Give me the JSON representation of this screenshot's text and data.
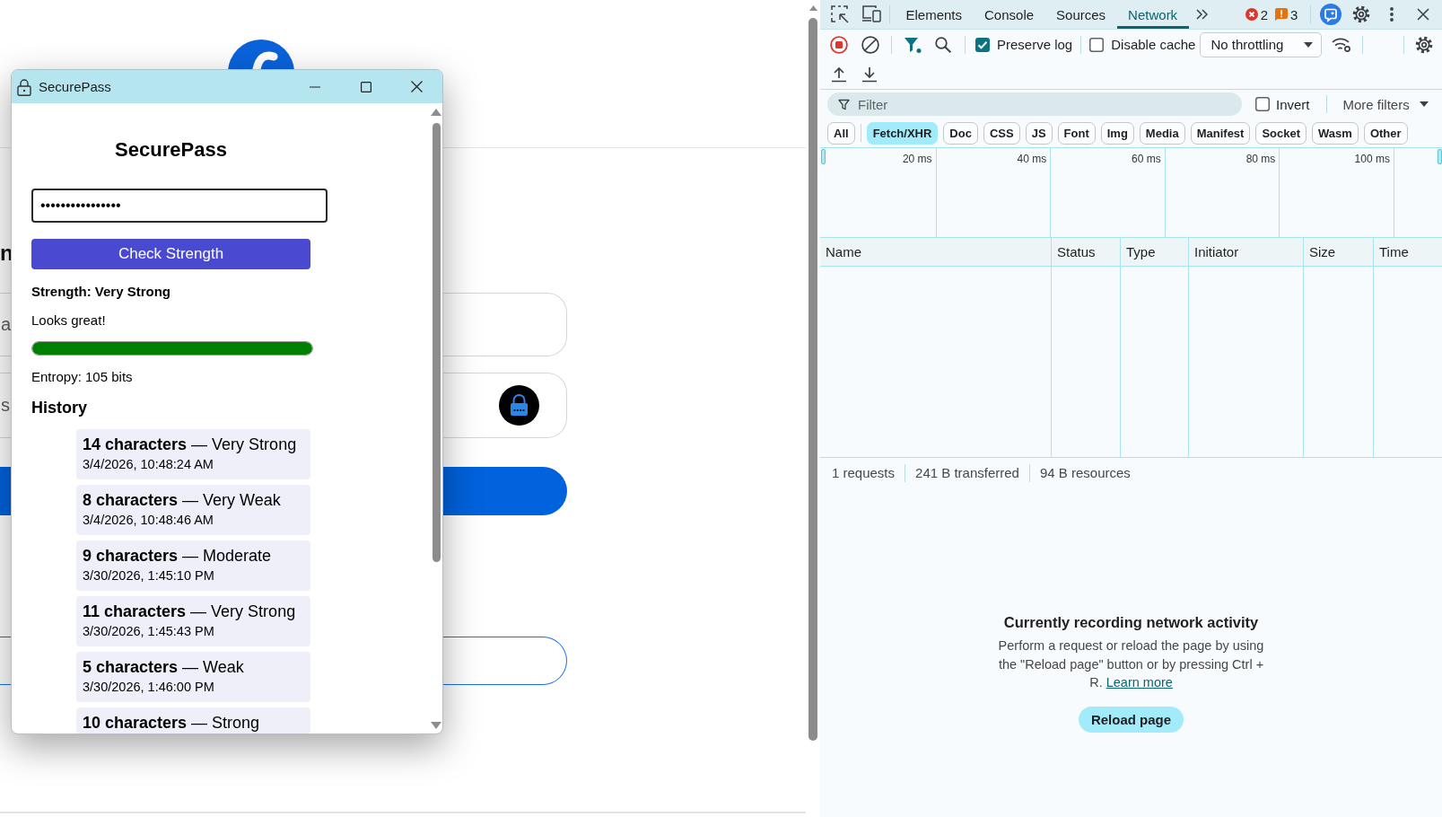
{
  "page_behind": {
    "heading": "n",
    "fields": [
      {
        "kind": "text",
        "text": "a"
      },
      {
        "kind": "password",
        "text": "s"
      }
    ]
  },
  "popup": {
    "title": "SecurePass",
    "heading": "SecurePass",
    "password_field": {
      "value": "••••••••••••••••"
    },
    "check_button": "Check Strength",
    "strength": "Strength: Very Strong",
    "message": "Looks great!",
    "strength_meter": {
      "level": 1
    },
    "entropy": "Entropy: 105 bits",
    "history_title": "History",
    "history": [
      {
        "title": "**14 characters** — Very Strong",
        "time": "3/4/2026, 10:48:24 AM"
      },
      {
        "title": "**8 characters** — Very Weak",
        "time": "3/4/2026, 10:48:46 AM"
      },
      {
        "title": "**9 characters** — Moderate",
        "time": "3/30/2026, 1:45:10 PM"
      },
      {
        "title": "**11 characters** — Very Strong",
        "time": "3/30/2026, 1:45:43 PM"
      },
      {
        "title": "**5 characters** — Weak",
        "time": "3/30/2026, 1:46:00 PM"
      },
      {
        "title": "**10 characters** — Strong"
      }
    ]
  },
  "devtools": {
    "tabs": [
      {
        "label": "Elements",
        "selected": false
      },
      {
        "label": "Console",
        "selected": false
      },
      {
        "label": "Sources",
        "selected": false
      },
      {
        "label": "Network",
        "selected": true
      }
    ],
    "issues": {
      "errors": "2",
      "warnings": "3"
    },
    "toolbar": {
      "preserve_log": {
        "label": "Preserve log",
        "checked": true
      },
      "disable_cache": {
        "label": "Disable cache",
        "checked": false
      },
      "throttling": "No throttling"
    },
    "filter": {
      "placeholder": "Filter",
      "invert": {
        "label": "Invert",
        "checked": false
      },
      "more_filters": "More filters"
    },
    "type_filters": [
      {
        "label": "All",
        "selected": false
      },
      {
        "label": "Fetch/XHR",
        "selected": true
      },
      {
        "label": "Doc",
        "selected": false
      },
      {
        "label": "CSS",
        "selected": false
      },
      {
        "label": "JS",
        "selected": false
      },
      {
        "label": "Font",
        "selected": false
      },
      {
        "label": "Img",
        "selected": false
      },
      {
        "label": "Media",
        "selected": false
      },
      {
        "label": "Manifest",
        "selected": false
      },
      {
        "label": "Socket",
        "selected": false
      },
      {
        "label": "Wasm",
        "selected": false
      },
      {
        "label": "Other",
        "selected": false
      }
    ],
    "timeline_ticks": [
      "20 ms",
      "40 ms",
      "60 ms",
      "80 ms",
      "100 ms"
    ],
    "table": {
      "columns": [
        "Name",
        "Status",
        "Type",
        "Initiator",
        "Size",
        "Time"
      ]
    },
    "status_bar": [
      "1 requests",
      "241 B transferred",
      "94 B resources"
    ],
    "empty_state": {
      "title": "Currently recording network activity",
      "text": "Perform a request or reload the page by using the \"Reload page\" button or by pressing Ctrl + R.",
      "link": "Learn more",
      "button": "Reload page"
    }
  }
}
